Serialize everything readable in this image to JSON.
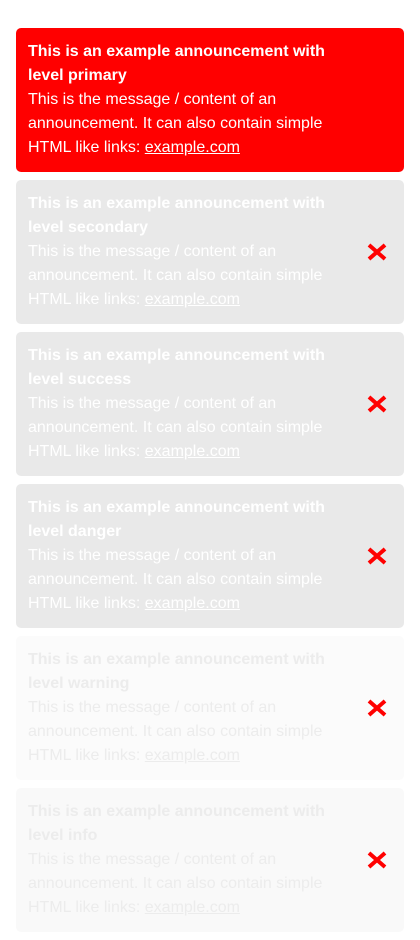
{
  "announcements": [
    {
      "level": "primary",
      "title": "This is an example announcement with level primary",
      "message": "This is the message / content of an announcement. It can also contain simple HTML like links: ",
      "link_text": "example.com",
      "dismissible": false
    },
    {
      "level": "secondary",
      "title": "This is an example announcement with level secondary",
      "message": "This is the message / content of an announcement. It can also contain simple HTML like links: ",
      "link_text": "example.com",
      "dismissible": true
    },
    {
      "level": "success",
      "title": "This is an example announcement with level success",
      "message": "This is the message / content of an announcement. It can also contain simple HTML like links: ",
      "link_text": "example.com",
      "dismissible": true
    },
    {
      "level": "danger",
      "title": "This is an example announcement with level danger",
      "message": "This is the message / content of an announcement. It can also contain simple HTML like links: ",
      "link_text": "example.com",
      "dismissible": true
    },
    {
      "level": "warning",
      "title": "This is an example announcement with level warning",
      "message": "This is the message / content of an announcement. It can also contain simple HTML like links: ",
      "link_text": "example.com",
      "dismissible": true
    },
    {
      "level": "info",
      "title": "This is an example announcement with level info",
      "message": "This is the message / content of an announcement. It can also contain simple HTML like links: ",
      "link_text": "example.com",
      "dismissible": true
    }
  ],
  "colors": {
    "primary_background": "#ff0000",
    "faded_background": "#e9e9e9",
    "close_icon": "#ff0000"
  },
  "icons": {
    "close": "close-icon"
  }
}
